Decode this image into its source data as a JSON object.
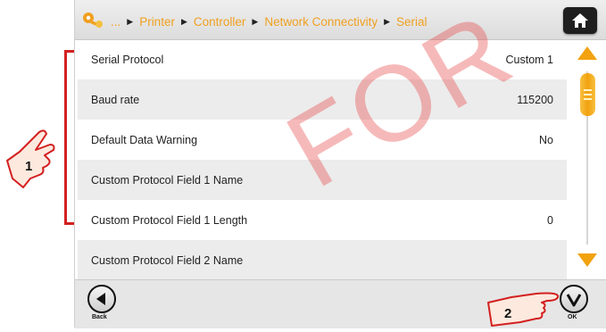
{
  "breadcrumb": {
    "ellipsis": "...",
    "items": [
      "Printer",
      "Controller",
      "Network Connectivity",
      "Serial"
    ]
  },
  "settings": [
    {
      "label": "Serial Protocol",
      "value": "Custom 1"
    },
    {
      "label": "Baud rate",
      "value": "115200"
    },
    {
      "label": "Default Data Warning",
      "value": "No"
    },
    {
      "label": "Custom Protocol Field 1 Name",
      "value": ""
    },
    {
      "label": "Custom Protocol Field 1 Length",
      "value": "0"
    },
    {
      "label": "Custom Protocol Field 2 Name",
      "value": ""
    }
  ],
  "footer": {
    "back_label": "Back",
    "ok_label": "OK"
  },
  "annotations": {
    "callout_1": "1",
    "callout_2": "2",
    "watermark": "FOR"
  },
  "colors": {
    "accent": "#f2a20f",
    "bracket": "#d32020",
    "home_button": "#1e1e1e"
  }
}
